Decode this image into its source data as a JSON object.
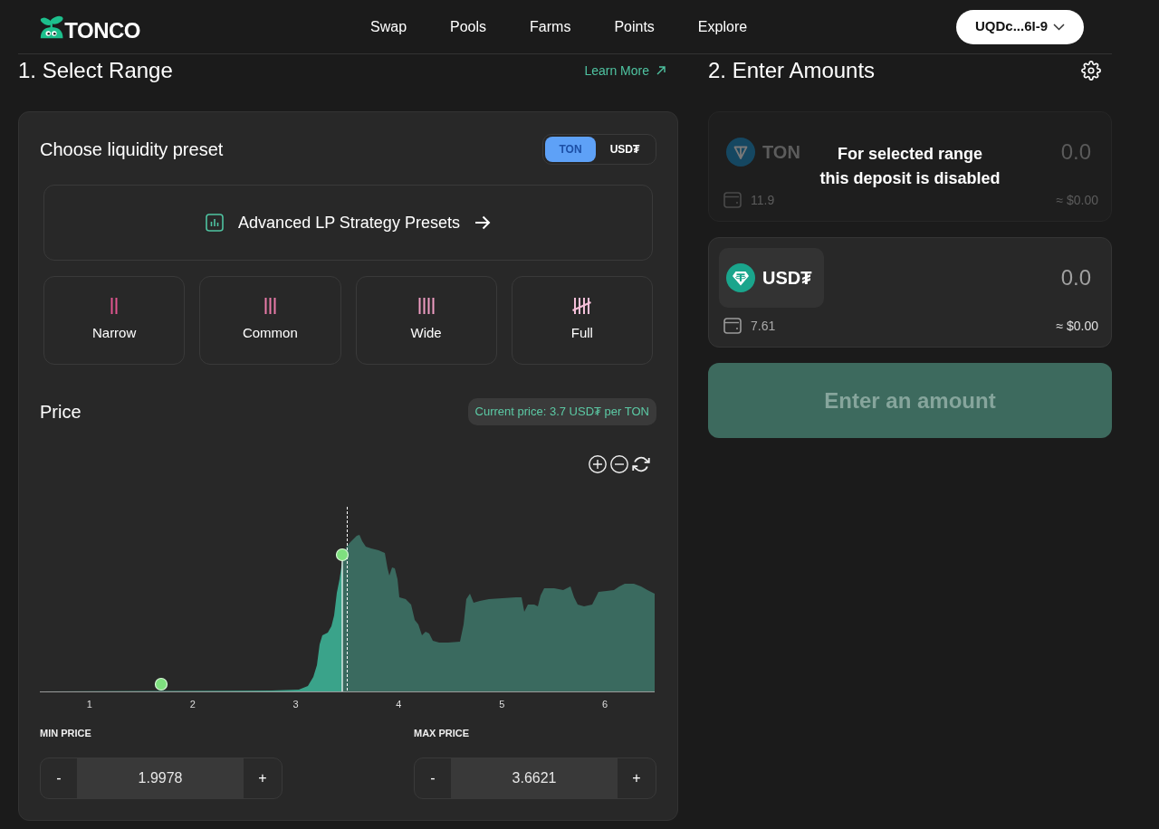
{
  "header": {
    "logo_text": "TONCO",
    "nav": [
      {
        "label": "Swap"
      },
      {
        "label": "Pools"
      },
      {
        "label": "Farms"
      },
      {
        "label": "Points"
      },
      {
        "label": "Explore"
      }
    ],
    "wallet_button": "UQDc...6I-9"
  },
  "range_panel": {
    "title": "1. Select Range",
    "learn_more": "Learn More",
    "preset_title": "Choose liquidity preset",
    "base_toggle": [
      {
        "label": "TON",
        "selected": true
      },
      {
        "label": "USD₮",
        "selected": false
      }
    ],
    "advanced_presets": "Advanced LP Strategy Presets",
    "presets": [
      {
        "label": "Narrow",
        "kind": "narrow"
      },
      {
        "label": "Common",
        "kind": "common"
      },
      {
        "label": "Wide",
        "kind": "wide"
      },
      {
        "label": "Full",
        "kind": "full"
      }
    ],
    "price_title": "Price",
    "current_price": "Current price: 3.7 USD₮ per TON",
    "chart_axis_labels": [
      "1",
      "2",
      "3",
      "4",
      "5",
      "6"
    ],
    "min_price": {
      "label": "MIN PRICE",
      "decrement": "-",
      "value": "1.9978",
      "increment": "+"
    },
    "max_price": {
      "label": "MAX PRICE",
      "decrement": "-",
      "value": "3.6621",
      "increment": "+"
    }
  },
  "amounts_panel": {
    "title": "2. Enter Amounts",
    "deposits": [
      {
        "token": "TON",
        "placeholder": "0.0",
        "balance": "11.9",
        "usd_value": "≈ $0.00",
        "disabled": true,
        "notice": "For selected range\nthis deposit is disabled"
      },
      {
        "token": "USD₮",
        "placeholder": "0.0",
        "balance": "7.61",
        "usd_value": "≈ $0.00",
        "disabled": false
      }
    ],
    "submit_button": {
      "label": "Enter an amount",
      "disabled": true
    }
  }
}
